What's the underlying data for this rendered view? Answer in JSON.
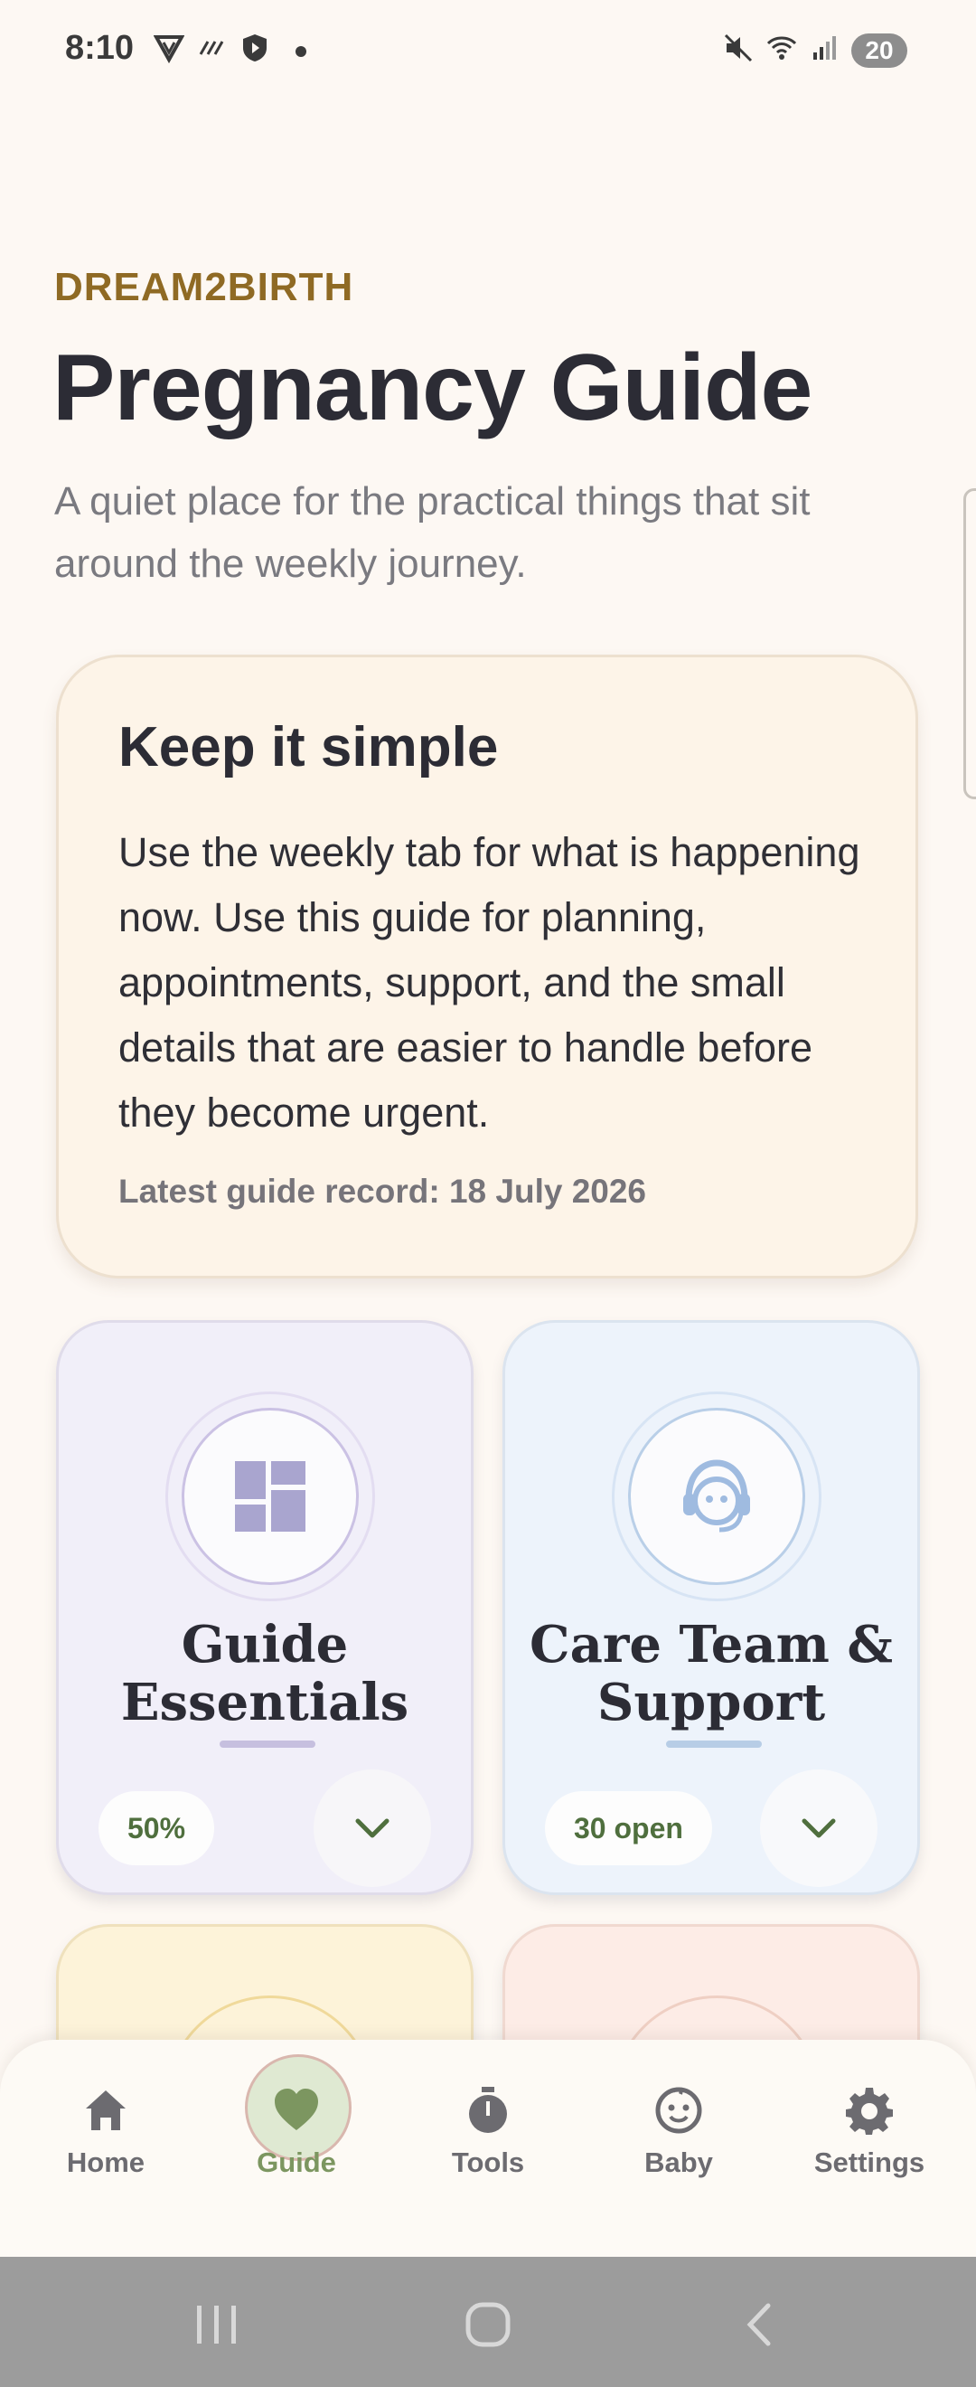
{
  "status_bar": {
    "time": "8:10",
    "battery": "20"
  },
  "header": {
    "brand": "DREAM2BIRTH",
    "title": "Pregnancy Guide",
    "subtitle": "A quiet place for the practical things that sit around the weekly journey."
  },
  "intro_card": {
    "heading": "Keep it simple",
    "body": "Use the weekly tab for what is happening now. Use this guide for planning, appointments, support, and the small details that are easier to handle before they become urgent.",
    "record": "Latest guide record: 18 July 2026"
  },
  "tiles": [
    {
      "title": "Guide Essentials",
      "badge": "50%",
      "icon": "dashboard-icon",
      "accent": "#c6bfdf"
    },
    {
      "title": "Care Team & Support",
      "badge": "30 open",
      "icon": "support-agent-icon",
      "accent": "#b7cde6"
    }
  ],
  "bottom_nav": [
    {
      "label": "Home",
      "icon": "home-icon"
    },
    {
      "label": "Guide",
      "icon": "heart-icon",
      "active": true
    },
    {
      "label": "Tools",
      "icon": "timer-icon"
    },
    {
      "label": "Baby",
      "icon": "baby-face-icon"
    },
    {
      "label": "Settings",
      "icon": "gear-icon"
    }
  ],
  "colors": {
    "background": "#fdf8f3",
    "brand": "#8f6a24",
    "active_nav": "#7c9660"
  }
}
